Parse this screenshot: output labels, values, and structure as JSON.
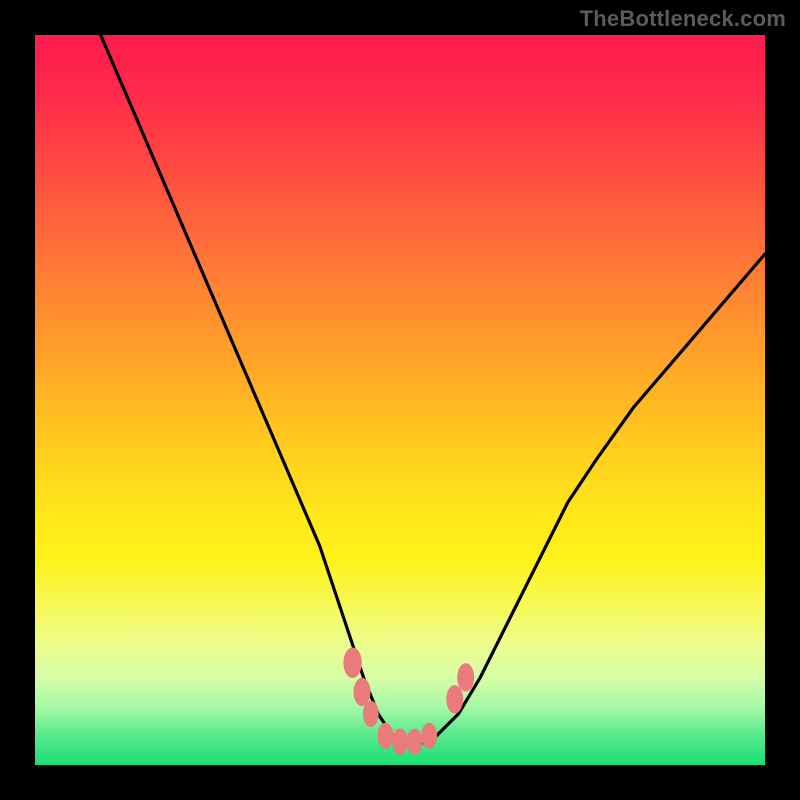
{
  "watermark": "TheBottleneck.com",
  "chart_data": {
    "type": "line",
    "title": "",
    "xlabel": "",
    "ylabel": "",
    "xlim": [
      0,
      100
    ],
    "ylim": [
      0,
      100
    ],
    "grid": false,
    "legend": false,
    "series": [
      {
        "name": "bottleneck-curve",
        "x": [
          9,
          12,
          15,
          18,
          21,
          24,
          27,
          30,
          33,
          36,
          39,
          41,
          43,
          45,
          47,
          49,
          51,
          53,
          55,
          58,
          61,
          64,
          67,
          70,
          73,
          77,
          82,
          88,
          94,
          100
        ],
        "y": [
          100,
          93,
          86,
          79,
          72,
          65,
          58,
          51,
          44,
          37,
          30,
          24,
          18,
          12,
          7,
          4,
          3,
          3,
          4,
          7,
          12,
          18,
          24,
          30,
          36,
          42,
          49,
          56,
          63,
          70
        ]
      }
    ],
    "markers": [
      {
        "name": "dot-left-1",
        "x": 43.5,
        "y": 14,
        "r": 1.4
      },
      {
        "name": "dot-left-2",
        "x": 44.8,
        "y": 10,
        "r": 1.3
      },
      {
        "name": "dot-left-3",
        "x": 46.0,
        "y": 7,
        "r": 1.2
      },
      {
        "name": "flat-1",
        "x": 48.0,
        "y": 4,
        "r": 1.2
      },
      {
        "name": "flat-2",
        "x": 50.0,
        "y": 3.2,
        "r": 1.2
      },
      {
        "name": "flat-3",
        "x": 52.0,
        "y": 3.2,
        "r": 1.2
      },
      {
        "name": "flat-4",
        "x": 54.0,
        "y": 4,
        "r": 1.2
      },
      {
        "name": "dot-right-1",
        "x": 57.5,
        "y": 9,
        "r": 1.3
      },
      {
        "name": "dot-right-2",
        "x": 59.0,
        "y": 12,
        "r": 1.3
      }
    ],
    "marker_color": "#e97b7b",
    "curve_color": "#000000"
  }
}
